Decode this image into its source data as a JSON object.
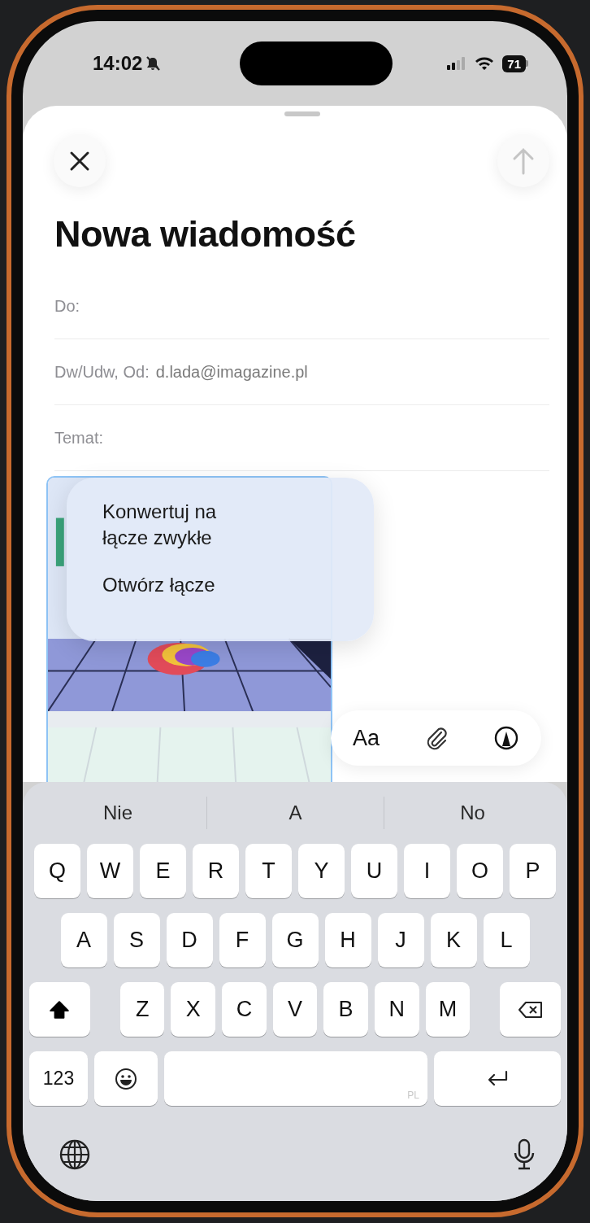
{
  "status_bar": {
    "time": "14:02",
    "silent": true,
    "battery": "71"
  },
  "compose": {
    "title": "Nowa wiadomość",
    "fields": [
      {
        "label": "Do:"
      },
      {
        "label": "Dw/Udw, Od:",
        "value": "d.lada@imagazine.pl"
      },
      {
        "label": "Temat:"
      }
    ],
    "link_preview": {
      "kind": "picture"
    },
    "context_menu": [
      "Konwertuj na łącze zwykłe",
      "Otwórz łącze"
    ],
    "format_bar": {
      "text_button": "Aa"
    }
  },
  "keyboard": {
    "suggestions": [
      "Nie",
      "A",
      "No"
    ],
    "rows": [
      [
        "Q",
        "W",
        "E",
        "R",
        "T",
        "Y",
        "U",
        "I",
        "O",
        "P"
      ],
      [
        "A",
        "S",
        "D",
        "F",
        "G",
        "H",
        "J",
        "K",
        "L"
      ],
      [
        "Z",
        "X",
        "C",
        "V",
        "B",
        "N",
        "M"
      ]
    ],
    "shift_on": true,
    "numbers_key": "123",
    "space_label": "PL"
  }
}
